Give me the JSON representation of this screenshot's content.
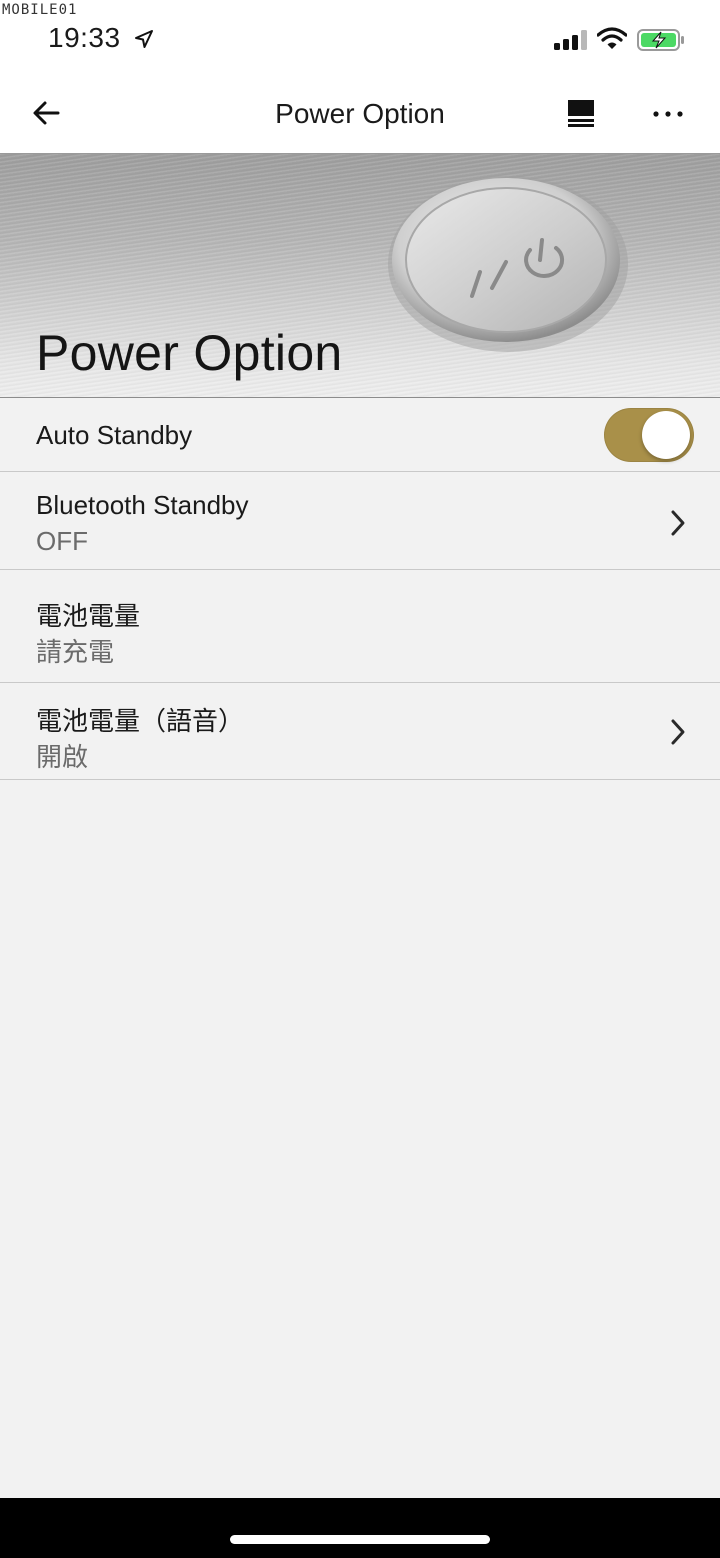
{
  "status_bar": {
    "watermark": "MOBILE01",
    "time": "19:33",
    "icons": [
      "location-arrow-icon",
      "cellular-signal-icon",
      "wifi-icon",
      "battery-charging-icon"
    ],
    "battery_color": "#4cd964"
  },
  "nav": {
    "title": "Power Option",
    "icons": [
      "back-arrow-icon",
      "queue-icon",
      "more-options-icon"
    ]
  },
  "hero": {
    "title": "Power Option"
  },
  "settings": {
    "auto_standby": {
      "label": "Auto Standby",
      "enabled": true
    },
    "bluetooth_standby": {
      "label": "Bluetooth Standby",
      "value": "OFF"
    },
    "battery_level": {
      "label": "電池電量",
      "value": "請充電"
    },
    "battery_voice": {
      "label": "電池電量（語音）",
      "value": "開啟"
    }
  },
  "colors": {
    "accent": "#a99049",
    "background": "#f2f2f2",
    "divider": "#c9c9c9"
  }
}
